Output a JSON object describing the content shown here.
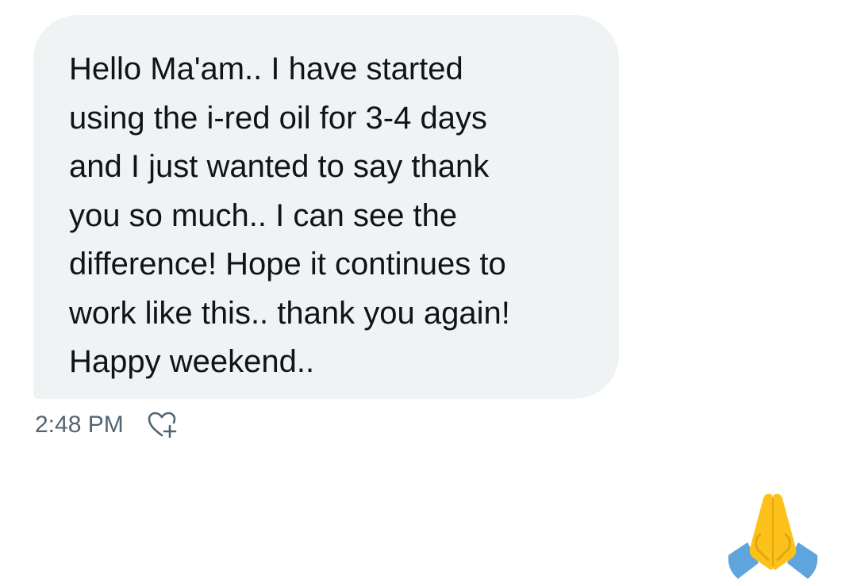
{
  "message": {
    "lines": [
      "Hello Ma'am.. I have started",
      "using the i-red oil for 3-4 days",
      "and I just wanted to say thank",
      "you so much.. I can see the",
      "difference! Hope it continues to",
      "work like this.. thank you again!",
      "Happy weekend.."
    ],
    "time": "2:48 PM",
    "reaction_icon": "heart-plus-icon"
  },
  "next_message": {
    "emoji_icon": "folded-hands-icon"
  },
  "colors": {
    "bubble_bg": "#eff3f4",
    "text": "#0f1419",
    "meta_text": "#536471",
    "emoji_skin": "#fcc21b",
    "emoji_sleeve": "#5ea4dd"
  }
}
